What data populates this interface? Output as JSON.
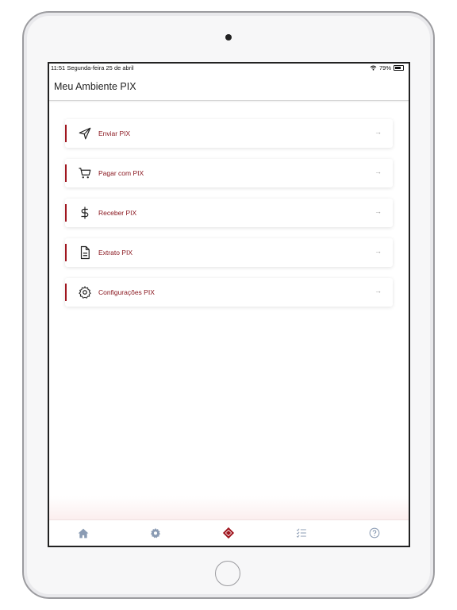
{
  "status_bar": {
    "time": "11:51",
    "date": "Segunda-feira 25 de abril",
    "battery": "79%"
  },
  "header": {
    "title": "Meu Ambiente PIX"
  },
  "menu": {
    "items": [
      {
        "label": "Enviar PIX",
        "icon": "send-icon"
      },
      {
        "label": "Pagar com PIX",
        "icon": "cart-icon"
      },
      {
        "label": "Receber PIX",
        "icon": "dollar-icon"
      },
      {
        "label": "Extrato PIX",
        "icon": "document-icon"
      },
      {
        "label": "Configurações PIX",
        "icon": "gear-icon"
      }
    ],
    "arrow": "→"
  },
  "tabbar": {
    "tabs": [
      "home-icon",
      "settings-icon",
      "pix-logo-icon",
      "checklist-icon",
      "help-icon"
    ]
  },
  "colors": {
    "accent": "#a0151e",
    "label": "#8a1820",
    "tab_inactive": "#8a9bb3"
  }
}
